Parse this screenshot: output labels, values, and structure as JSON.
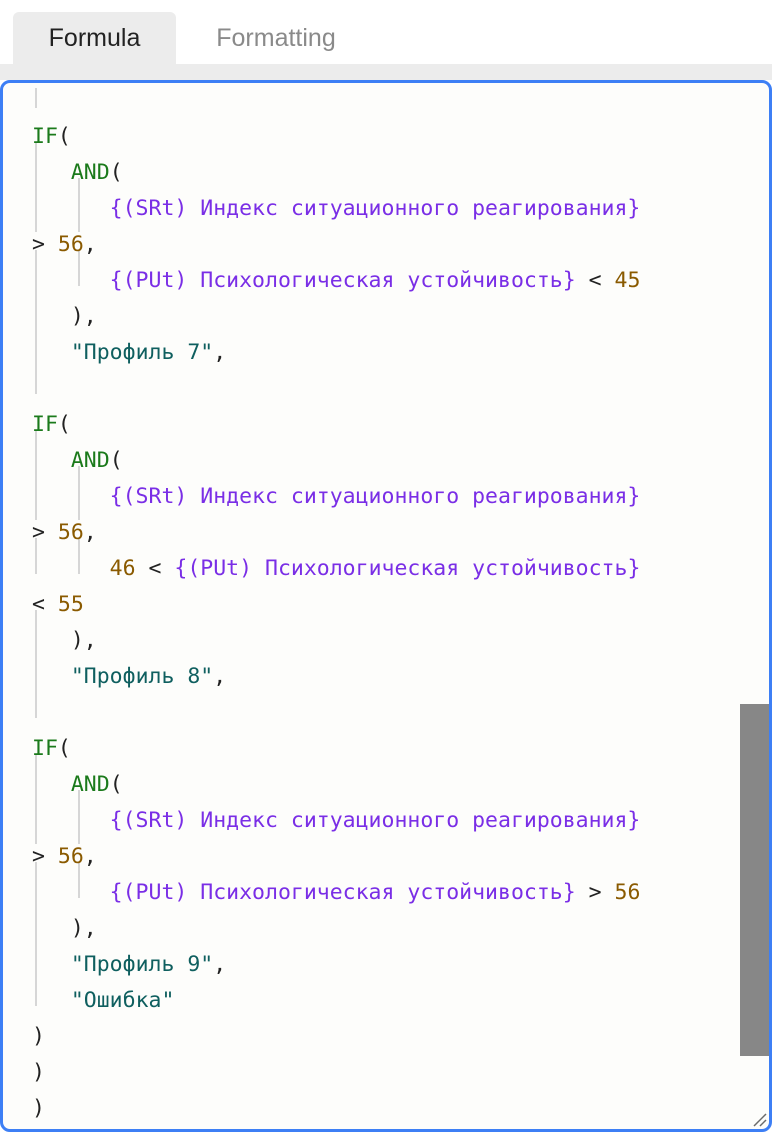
{
  "tabs": [
    {
      "label": "Formula",
      "active": true
    },
    {
      "label": "Formatting",
      "active": false
    }
  ],
  "colors": {
    "function": "#1b7a1b",
    "field": "#7a2ee6",
    "number": "#8a5a00",
    "string": "#0f5f5f",
    "punctuation": "#222222",
    "focus_border": "#3d7ff5"
  },
  "code_lines": [
    [],
    [
      {
        "t": "IF",
        "k": "fn"
      },
      {
        "t": "(",
        "k": "p"
      }
    ],
    [
      {
        "t": "   "
      },
      {
        "t": "AND",
        "k": "fn"
      },
      {
        "t": "(",
        "k": "p"
      }
    ],
    [
      {
        "t": "      "
      },
      {
        "t": "{(SRt) Индекс ситуационного реагирования}",
        "k": "fld"
      }
    ],
    [
      {
        "t": "> ",
        "k": "p"
      },
      {
        "t": "56",
        "k": "n"
      },
      {
        "t": ",",
        "k": "p"
      }
    ],
    [
      {
        "t": "      "
      },
      {
        "t": "{(PUt) Психологическая устойчивость}",
        "k": "fld"
      },
      {
        "t": " < ",
        "k": "p"
      },
      {
        "t": "45",
        "k": "n"
      }
    ],
    [
      {
        "t": "   "
      },
      {
        "t": "),",
        "k": "p"
      }
    ],
    [
      {
        "t": "   "
      },
      {
        "t": "\"Профиль 7\"",
        "k": "s"
      },
      {
        "t": ",",
        "k": "p"
      }
    ],
    [],
    [
      {
        "t": "IF",
        "k": "fn"
      },
      {
        "t": "(",
        "k": "p"
      }
    ],
    [
      {
        "t": "   "
      },
      {
        "t": "AND",
        "k": "fn"
      },
      {
        "t": "(",
        "k": "p"
      }
    ],
    [
      {
        "t": "      "
      },
      {
        "t": "{(SRt) Индекс ситуационного реагирования}",
        "k": "fld"
      }
    ],
    [
      {
        "t": "> ",
        "k": "p"
      },
      {
        "t": "56",
        "k": "n"
      },
      {
        "t": ",",
        "k": "p"
      }
    ],
    [
      {
        "t": "      "
      },
      {
        "t": "46",
        "k": "n"
      },
      {
        "t": " < ",
        "k": "p"
      },
      {
        "t": "{(PUt) Психологическая устойчивость}",
        "k": "fld"
      }
    ],
    [
      {
        "t": "< ",
        "k": "p"
      },
      {
        "t": "55",
        "k": "n"
      }
    ],
    [
      {
        "t": "   "
      },
      {
        "t": "),",
        "k": "p"
      }
    ],
    [
      {
        "t": "   "
      },
      {
        "t": "\"Профиль 8\"",
        "k": "s"
      },
      {
        "t": ",",
        "k": "p"
      }
    ],
    [],
    [
      {
        "t": "IF",
        "k": "fn"
      },
      {
        "t": "(",
        "k": "p"
      }
    ],
    [
      {
        "t": "   "
      },
      {
        "t": "AND",
        "k": "fn"
      },
      {
        "t": "(",
        "k": "p"
      }
    ],
    [
      {
        "t": "      "
      },
      {
        "t": "{(SRt) Индекс ситуационного реагирования}",
        "k": "fld"
      }
    ],
    [
      {
        "t": "> ",
        "k": "p"
      },
      {
        "t": "56",
        "k": "n"
      },
      {
        "t": ",",
        "k": "p"
      }
    ],
    [
      {
        "t": "      "
      },
      {
        "t": "{(PUt) Психологическая устойчивость}",
        "k": "fld"
      },
      {
        "t": " > ",
        "k": "p"
      },
      {
        "t": "56",
        "k": "n"
      }
    ],
    [
      {
        "t": "   "
      },
      {
        "t": "),",
        "k": "p"
      }
    ],
    [
      {
        "t": "   "
      },
      {
        "t": "\"Профиль 9\"",
        "k": "s"
      },
      {
        "t": ",",
        "k": "p"
      }
    ],
    [
      {
        "t": "   "
      },
      {
        "t": "\"Ошибка\"",
        "k": "s"
      }
    ],
    [
      {
        "t": ")",
        "k": "p"
      }
    ],
    [
      {
        "t": ")",
        "k": "p"
      }
    ],
    [
      {
        "t": ")",
        "k": "p"
      }
    ],
    [
      {
        "t": ")",
        "k": "p"
      }
    ]
  ]
}
